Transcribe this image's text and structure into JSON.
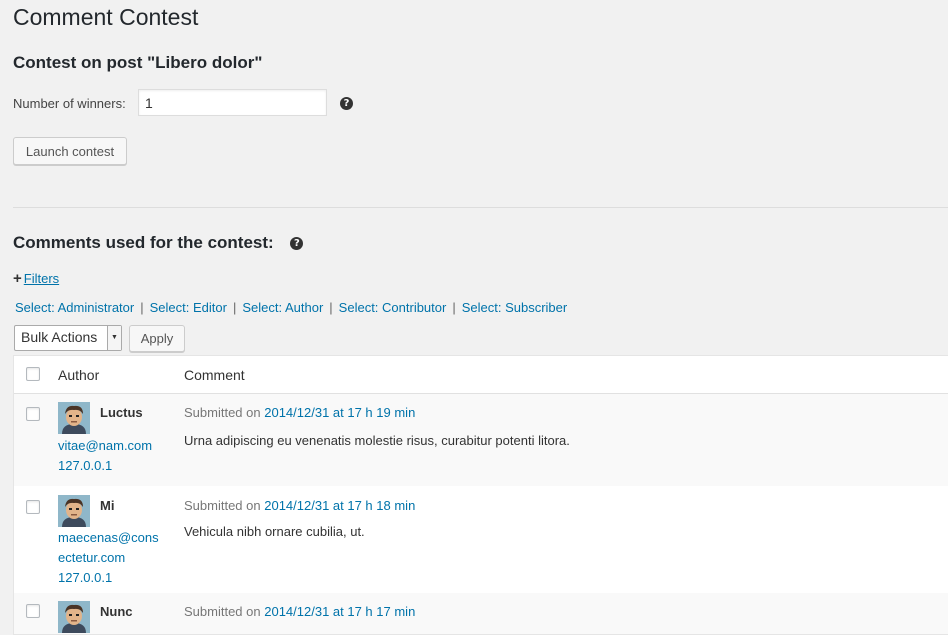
{
  "page": {
    "title": "Comment Contest"
  },
  "contest": {
    "heading": "Contest on post \"Libero dolor\"",
    "winners_label": "Number of winners:",
    "winners_value": "1",
    "help_glyph": "?",
    "launch_label": "Launch contest"
  },
  "comments_section": {
    "heading": "Comments used for the contest:",
    "help_glyph": "?",
    "filters_plus": "+",
    "filters_label": "Filters",
    "role_links": [
      "Select: Administrator",
      "Select: Editor",
      "Select: Author",
      "Select: Contributor",
      "Select: Subscriber"
    ],
    "separator": "|",
    "bulk_actions": "Bulk Actions",
    "apply_label": "Apply",
    "columns": {
      "author": "Author",
      "comment": "Comment"
    },
    "rows": [
      {
        "name": "Luctus",
        "email_lines": [
          "vitae@nam.com"
        ],
        "ip": "127.0.0.1",
        "submitted_prefix": "Submitted on",
        "date": "2014/12/31 at 17 h 19 min",
        "text": "Urna adipiscing eu venenatis molestie risus, curabitur potenti litora."
      },
      {
        "name": "Mi",
        "email_lines": [
          "maecenas@cons",
          "ectetur.com"
        ],
        "ip": "127.0.0.1",
        "submitted_prefix": "Submitted on",
        "date": "2014/12/31 at 17 h 18 min",
        "text": "Vehicula nibh ornare cubilia, ut."
      },
      {
        "name": "Nunc",
        "email_lines": [],
        "ip": "",
        "submitted_prefix": "Submitted on",
        "date": "2014/12/31 at 17 h 17 min",
        "text": ""
      }
    ]
  },
  "colors": {
    "link": "#0073aa",
    "background": "#f1f1f1",
    "heading": "#23282d"
  }
}
